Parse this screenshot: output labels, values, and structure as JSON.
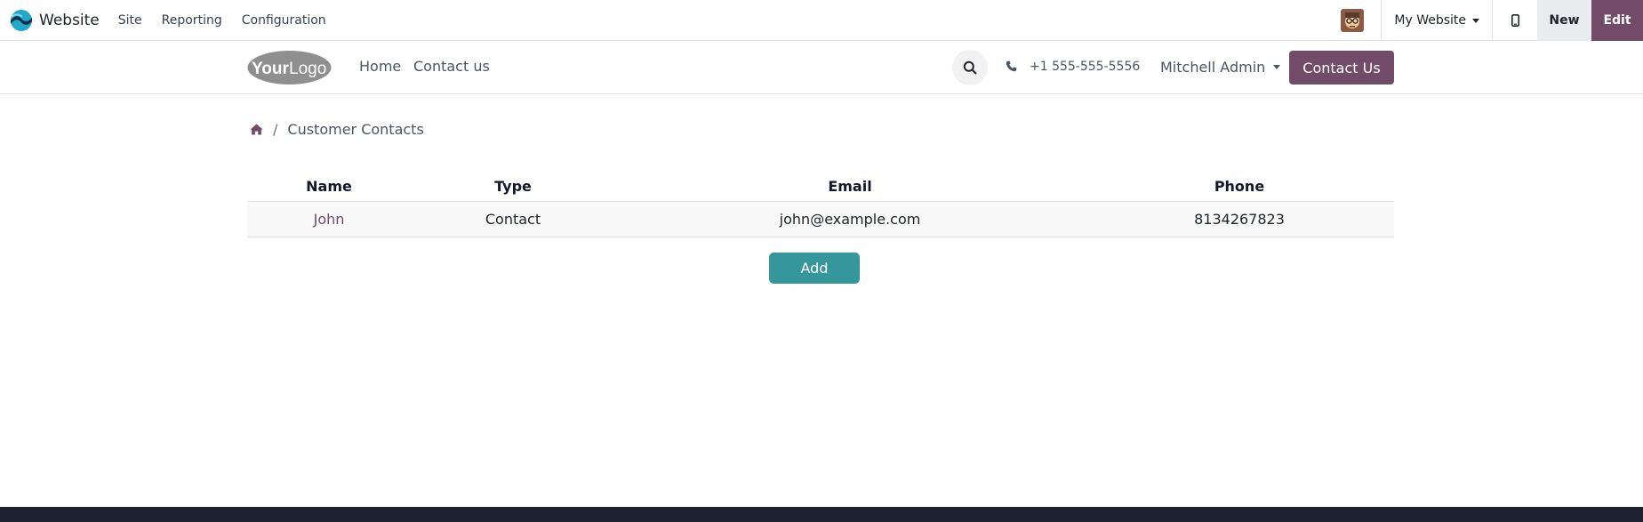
{
  "admin_bar": {
    "app_name": "Website",
    "menu": [
      "Site",
      "Reporting",
      "Configuration"
    ],
    "website_selector": "My Website",
    "new_label": "New",
    "edit_label": "Edit",
    "brand_color": "#714b67"
  },
  "site_header": {
    "logo_text_1": "Your",
    "logo_text_2": "Logo",
    "nav": [
      "Home",
      "Contact us"
    ],
    "phone": "+1 555-555-5556",
    "user": "Mitchell Admin",
    "cta_label": "Contact Us"
  },
  "breadcrumb": {
    "separator": "/",
    "current": "Customer Contacts"
  },
  "contacts_table": {
    "columns": [
      "Name",
      "Type",
      "Email",
      "Phone"
    ],
    "rows": [
      {
        "name": "John",
        "type": "Contact",
        "email": "john@example.com",
        "phone": "8134267823"
      }
    ]
  },
  "add_label": "Add",
  "colors": {
    "primary": "#714b67",
    "teal": "#35979c",
    "footer": "#1e2130"
  }
}
